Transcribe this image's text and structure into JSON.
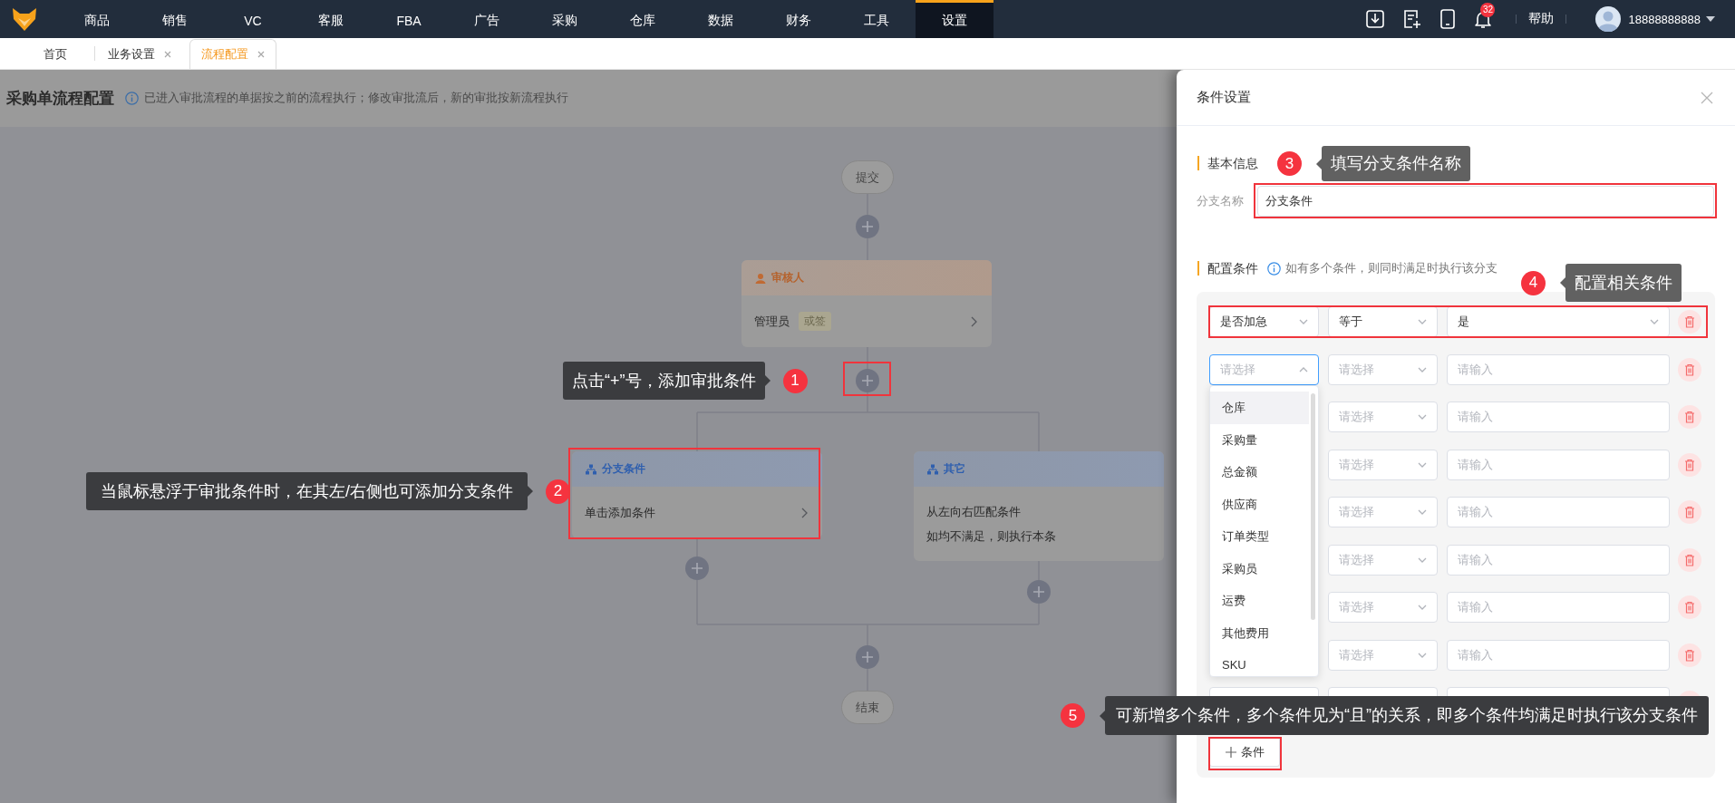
{
  "top_nav": {
    "items": [
      {
        "label": "商品",
        "selected": false
      },
      {
        "label": "销售",
        "selected": false
      },
      {
        "label": "VC",
        "selected": false
      },
      {
        "label": "客服",
        "selected": false
      },
      {
        "label": "FBA",
        "selected": false
      },
      {
        "label": "广告",
        "selected": false
      },
      {
        "label": "采购",
        "selected": false
      },
      {
        "label": "仓库",
        "selected": false
      },
      {
        "label": "数据",
        "selected": false
      },
      {
        "label": "财务",
        "selected": false
      },
      {
        "label": "工具",
        "selected": false
      },
      {
        "label": "设置",
        "selected": true
      }
    ],
    "notification_count": "32",
    "help": "帮助",
    "user": "18888888888"
  },
  "tabs": [
    {
      "label": "首页",
      "selected": false,
      "closable": false
    },
    {
      "label": "业务设置",
      "selected": false,
      "closable": true
    },
    {
      "label": "流程配置",
      "selected": true,
      "closable": true
    }
  ],
  "page": {
    "title": "采购单流程配置",
    "notice": "已进入审批流程的单据按之前的流程执行；修改审批流后，新的审批按新流程执行"
  },
  "flow": {
    "start": "提交",
    "approver": {
      "title": "审核人",
      "assignee": "管理员",
      "tag": "或签"
    },
    "branches": [
      {
        "kind": "condition",
        "title": "分支条件",
        "lines": [
          "单击添加条件"
        ]
      },
      {
        "kind": "default",
        "title": "其它",
        "lines": [
          "从左向右匹配条件",
          "如均不满足，则执行本条"
        ]
      }
    ],
    "end": "结束"
  },
  "drawer": {
    "title": "条件设置",
    "basic_heading": "基本信息",
    "name_label": "分支名称",
    "name_value": "分支条件",
    "conditions_heading": "配置条件",
    "conditions_hint": "如有多个条件，则同时满足时执行该分支",
    "rows": [
      {
        "cells": [
          {
            "kind": "select",
            "value": "是否加急",
            "open": false
          },
          {
            "kind": "select",
            "value": "等于",
            "open": false
          },
          {
            "kind": "select",
            "value": "是",
            "open": false
          }
        ]
      },
      {
        "cells": [
          {
            "kind": "select",
            "placeholder": "请选择",
            "open": true
          },
          {
            "kind": "select",
            "placeholder": "请选择",
            "open": false
          },
          {
            "kind": "input",
            "placeholder": "请输入"
          }
        ]
      },
      {
        "cells": [
          {
            "kind": "covered"
          },
          {
            "kind": "select",
            "placeholder": "请选择",
            "open": false
          },
          {
            "kind": "input",
            "placeholder": "请输入"
          }
        ]
      },
      {
        "cells": [
          {
            "kind": "covered"
          },
          {
            "kind": "select",
            "placeholder": "请选择",
            "open": false
          },
          {
            "kind": "input",
            "placeholder": "请输入"
          }
        ]
      },
      {
        "cells": [
          {
            "kind": "covered"
          },
          {
            "kind": "select",
            "placeholder": "请选择",
            "open": false
          },
          {
            "kind": "input",
            "placeholder": "请输入"
          }
        ]
      },
      {
        "cells": [
          {
            "kind": "covered"
          },
          {
            "kind": "select",
            "placeholder": "请选择",
            "open": false
          },
          {
            "kind": "input",
            "placeholder": "请输入"
          }
        ]
      },
      {
        "cells": [
          {
            "kind": "covered"
          },
          {
            "kind": "select",
            "placeholder": "请选择",
            "open": false
          },
          {
            "kind": "input",
            "placeholder": "请输入"
          }
        ]
      },
      {
        "cells": [
          {
            "kind": "covered"
          },
          {
            "kind": "select",
            "placeholder": "请选择",
            "open": false
          },
          {
            "kind": "input",
            "placeholder": "请输入"
          }
        ]
      },
      {
        "cells": [
          {
            "kind": "select",
            "open": false
          },
          {
            "kind": "select",
            "open": false
          },
          {
            "kind": "input"
          }
        ]
      }
    ],
    "dropdown": {
      "items": [
        {
          "label": "仓库",
          "highlighted": true
        },
        {
          "label": "采购量",
          "highlighted": false
        },
        {
          "label": "总金额",
          "highlighted": false
        },
        {
          "label": "供应商",
          "highlighted": false
        },
        {
          "label": "订单类型",
          "highlighted": false
        },
        {
          "label": "采购员",
          "highlighted": false
        },
        {
          "label": "运费",
          "highlighted": false
        },
        {
          "label": "其他费用",
          "highlighted": false
        },
        {
          "label": "SKU",
          "highlighted": false
        }
      ]
    },
    "add_button": "条件"
  },
  "annotations": [
    {
      "number": "1",
      "text": "点击“+”号，添加审批条件",
      "framed": true
    },
    {
      "number": "2",
      "text": "当鼠标悬浮于审批条件时，在其左/右侧也可添加分支条件",
      "framed": true
    },
    {
      "number": "3",
      "text": "填写分支条件名称",
      "framed": true
    },
    {
      "number": "4",
      "text": "配置相关条件",
      "framed": true
    },
    {
      "number": "5",
      "text": "可新增多个条件，多个条件见为“且”的关系，即多个条件均满足时执行该分支条件",
      "framed": true
    }
  ]
}
